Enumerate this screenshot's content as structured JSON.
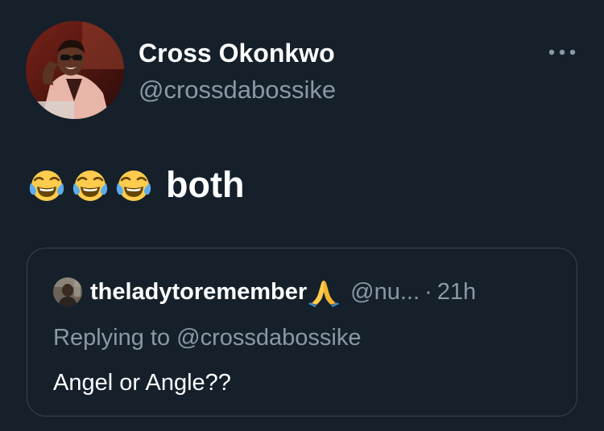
{
  "tweet": {
    "author_name": "Cross Okonkwo",
    "author_handle": "@crossdabossike",
    "emojis": [
      "face-with-tears-of-joy",
      "face-with-tears-of-joy",
      "face-with-tears-of-joy"
    ],
    "text": "both"
  },
  "quoted_tweet": {
    "author_name": "theladytoremember",
    "name_emoji": "folded-hands",
    "handle": "@nu...",
    "separator": "·",
    "time": "21h",
    "replying_prefix": "Replying to ",
    "replying_to": "@crossdabossike",
    "text": "Angel or Angle??"
  },
  "colors": {
    "background": "#15202b",
    "text_primary": "#ffffff",
    "text_secondary": "#8b98a5",
    "card_border": "#38444d"
  },
  "icons": {
    "more": "more-horizontal-icon"
  }
}
